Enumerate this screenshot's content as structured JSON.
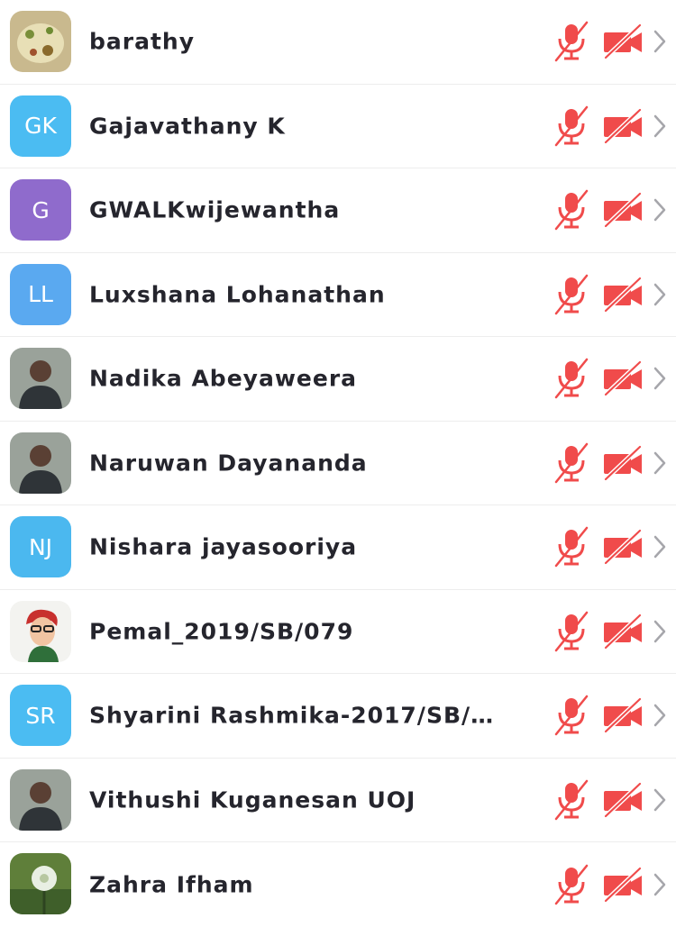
{
  "participants": [
    {
      "name": "barathy",
      "avatar_type": "photo",
      "avatar_icon": "food-photo-avatar"
    },
    {
      "name": "Gajavathany K",
      "avatar_type": "initials",
      "initials": "GK",
      "avatar_color": "#4bbcf2"
    },
    {
      "name": "GWALKwijewantha",
      "avatar_type": "initials",
      "initials": "G",
      "avatar_color": "#8f6bcc"
    },
    {
      "name": "Luxshana Lohanathan",
      "avatar_type": "initials",
      "initials": "LL",
      "avatar_color": "#5aa9f0"
    },
    {
      "name": "Nadika Abeyaweera",
      "avatar_type": "photo",
      "avatar_icon": "person-photo-avatar"
    },
    {
      "name": "Naruwan Dayananda",
      "avatar_type": "photo",
      "avatar_icon": "person-photo-avatar"
    },
    {
      "name": "Nishara jayasooriya",
      "avatar_type": "initials",
      "initials": "NJ",
      "avatar_color": "#4bb8ef"
    },
    {
      "name": "Pemal_2019/SB/079",
      "avatar_type": "photo",
      "avatar_icon": "cartoon-avatar"
    },
    {
      "name": "Shyarini Rashmika-2017/SB/…",
      "avatar_type": "initials",
      "initials": "SR",
      "avatar_color": "#4bbcf2"
    },
    {
      "name": "Vithushi Kuganesan UOJ",
      "avatar_type": "photo",
      "avatar_icon": "person-photo-avatar"
    },
    {
      "name": "Zahra Ifham",
      "avatar_type": "photo",
      "avatar_icon": "flower-photo-avatar"
    }
  ],
  "icons": {
    "mic": "mic-muted-icon",
    "camera": "video-off-icon",
    "chevron": "chevron-right-icon"
  },
  "colors": {
    "muted_red": "#f04b4b",
    "name_text": "#25252d",
    "chevron": "#a6a6ab",
    "divider": "#ededed"
  }
}
